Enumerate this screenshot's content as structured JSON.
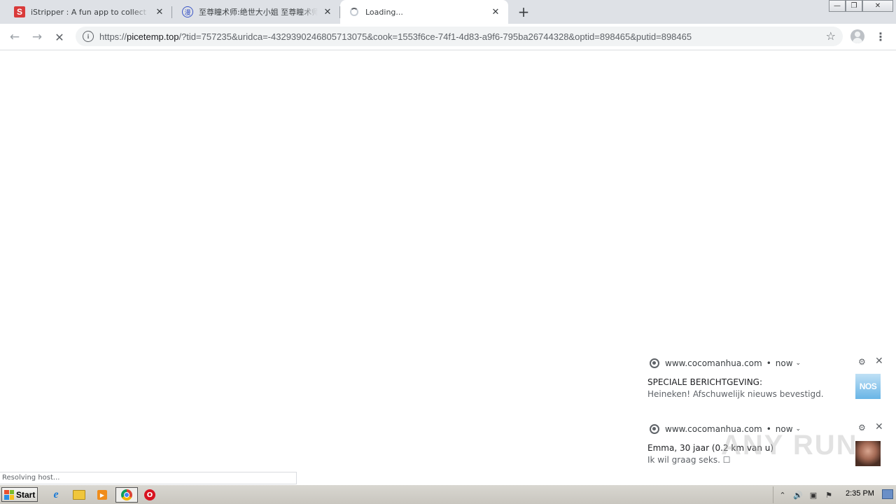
{
  "browser": {
    "tabs": [
      {
        "title": "iStripper : A fun app to collect and watch",
        "favicon": "S",
        "close": "✕"
      },
      {
        "title": "至尊瞳术师:绝世大小姐 至尊瞳术师",
        "favicon": "漫",
        "close": "✕"
      },
      {
        "title": "Loading...",
        "close": "✕"
      }
    ],
    "new_tab": "+",
    "window_controls": {
      "minimize": "—",
      "restore": "❐",
      "close": "✕"
    },
    "toolbar": {
      "back": "←",
      "forward": "→",
      "stop": "✕",
      "info": "i",
      "star": "☆",
      "menu": "⋮"
    },
    "url": {
      "scheme": "https://",
      "host": "picetemp.top",
      "path": "/?tid=757235&uridca=-4329390246805713075&cook=1553f6ce-74f1-4d83-a9f6-795ba26744328&optid=898465&putid=898465"
    },
    "status": "Resolving host..."
  },
  "notifications": [
    {
      "source": "www.cocomanhua.com",
      "time": "now",
      "title": "SPECIALE BERICHTGEVING:",
      "body": "Heineken! Afschuwelijk nieuws bevestigd.",
      "thumb_label": "NOS",
      "gear": "⚙",
      "close": "✕"
    },
    {
      "source": "www.cocomanhua.com",
      "time": "now",
      "title": "Emma, 30 jaar (0.2 km van u)",
      "body": "Ik wil graag seks. ☐",
      "gear": "⚙",
      "close": "✕"
    }
  ],
  "watermark": "ANY RUN",
  "taskbar": {
    "start_label": "Start",
    "clock": "2:35 PM",
    "tray": [
      "⌃",
      "🔊",
      "▣",
      "⚑"
    ]
  }
}
